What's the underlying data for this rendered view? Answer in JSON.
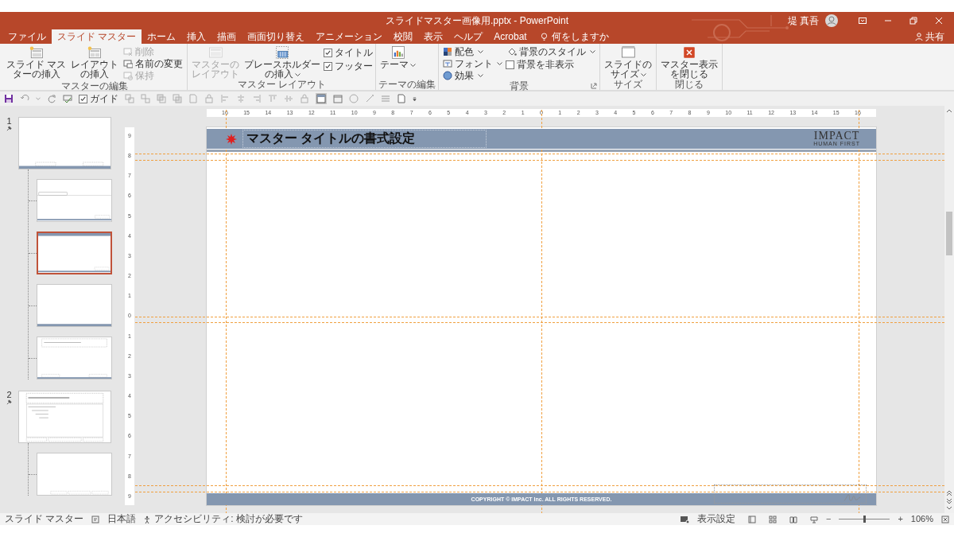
{
  "window": {
    "title": "スライドマスター画像用.pptx - PowerPoint",
    "user": "堤 真吾"
  },
  "tabs": [
    {
      "label": "ファイル",
      "selected": false
    },
    {
      "label": "スライド マスター",
      "selected": true
    },
    {
      "label": "ホーム",
      "selected": false
    },
    {
      "label": "挿入",
      "selected": false
    },
    {
      "label": "描画",
      "selected": false
    },
    {
      "label": "画面切り替え",
      "selected": false
    },
    {
      "label": "アニメーション",
      "selected": false
    },
    {
      "label": "校閲",
      "selected": false
    },
    {
      "label": "表示",
      "selected": false
    },
    {
      "label": "ヘルプ",
      "selected": false
    },
    {
      "label": "Acrobat",
      "selected": false
    }
  ],
  "tell_me": "何をしますか",
  "share": "共有",
  "ribbon": {
    "groups": [
      {
        "label": "マスターの編集",
        "launcher": false,
        "columns": [
          [
            {
              "kind": "large",
              "lines": [
                "スライド マス",
                "ターの挿入"
              ],
              "disabled": false,
              "dropdown": false
            }
          ],
          [
            {
              "kind": "large",
              "lines": [
                "レイアウト",
                "の挿入"
              ],
              "disabled": false,
              "dropdown": false
            }
          ],
          [
            {
              "kind": "small",
              "label": "削除",
              "disabled": true,
              "dropdown": false
            },
            {
              "kind": "small",
              "label": "名前の変更",
              "disabled": false,
              "dropdown": false
            },
            {
              "kind": "small",
              "label": "保持",
              "disabled": true,
              "dropdown": false
            }
          ]
        ]
      },
      {
        "label": "マスター レイアウト",
        "launcher": false,
        "columns": [
          [
            {
              "kind": "large",
              "lines": [
                "マスターの",
                "レイアウト"
              ],
              "disabled": true,
              "dropdown": false
            }
          ],
          [
            {
              "kind": "large",
              "lines": [
                "プレースホルダー",
                "の挿入"
              ],
              "disabled": false,
              "dropdown": true
            }
          ],
          [
            {
              "kind": "check",
              "label": "タイトル",
              "checked": true
            },
            {
              "kind": "check",
              "label": "フッター",
              "checked": true
            }
          ]
        ]
      },
      {
        "label": "テーマの編集",
        "launcher": false,
        "columns": [
          [
            {
              "kind": "large",
              "lines": [
                "テーマ"
              ],
              "disabled": false,
              "dropdown": true
            }
          ]
        ]
      },
      {
        "label": "背景",
        "launcher": true,
        "columns": [
          [
            {
              "kind": "small",
              "label": "配色",
              "disabled": false,
              "dropdown": true
            },
            {
              "kind": "small",
              "label": "フォント",
              "disabled": false,
              "dropdown": true
            },
            {
              "kind": "small",
              "label": "効果",
              "disabled": false,
              "dropdown": true
            }
          ],
          [
            {
              "kind": "small",
              "label": "背景のスタイル",
              "disabled": false,
              "dropdown": true
            },
            {
              "kind": "check",
              "label": "背景を非表示",
              "checked": false
            }
          ]
        ]
      },
      {
        "label": "サイズ",
        "launcher": false,
        "columns": [
          [
            {
              "kind": "large",
              "lines": [
                "スライドの",
                "サイズ"
              ],
              "disabled": false,
              "dropdown": true
            }
          ]
        ]
      },
      {
        "label": "閉じる",
        "launcher": false,
        "columns": [
          [
            {
              "kind": "large",
              "lines": [
                "マスター表示",
                "を閉じる"
              ],
              "disabled": false,
              "dropdown": false
            }
          ]
        ]
      }
    ]
  },
  "quick_access": {
    "guide": {
      "label": "ガイド",
      "checked": true
    }
  },
  "slides": [
    {
      "number": "1",
      "kind": "master",
      "selected": false,
      "children": [
        {
          "kind": "title-only",
          "selected": false
        },
        {
          "kind": "header-band",
          "selected": true
        },
        {
          "kind": "blank",
          "selected": false
        },
        {
          "kind": "title-box",
          "selected": false
        }
      ]
    },
    {
      "number": "2",
      "kind": "outline",
      "selected": false,
      "children": [
        {
          "kind": "footer-boxes",
          "selected": false
        }
      ]
    }
  ],
  "ruler": {
    "horizontal": [
      "16",
      "15",
      "14",
      "13",
      "12",
      "11",
      "10",
      "9",
      "8",
      "7",
      "6",
      "5",
      "4",
      "3",
      "2",
      "1",
      "0",
      "1",
      "2",
      "3",
      "4",
      "5",
      "6",
      "7",
      "8",
      "9",
      "10",
      "11",
      "12",
      "13",
      "14",
      "15",
      "16"
    ],
    "vertical": [
      "9",
      "8",
      "7",
      "6",
      "5",
      "4",
      "3",
      "2",
      "1",
      "0",
      "1",
      "2",
      "3",
      "4",
      "5",
      "6",
      "7",
      "8",
      "9"
    ]
  },
  "slide": {
    "title": "マスター タイトルの書式設定",
    "logo": "IMPACT",
    "logo_tagline": "HUMAN FIRST",
    "footer": "COPYRIGHT © IMPACT Inc. ALL RIGHTS RESERVED."
  },
  "status_bar": {
    "mode": "スライド マスター",
    "language": "日本語",
    "accessibility": "アクセシビリティ: 検討が必要です",
    "display_settings": "表示設定",
    "zoom_out": "−",
    "zoom_in": "+",
    "zoom": {
      "level": 0.5,
      "reading": "106%"
    }
  }
}
